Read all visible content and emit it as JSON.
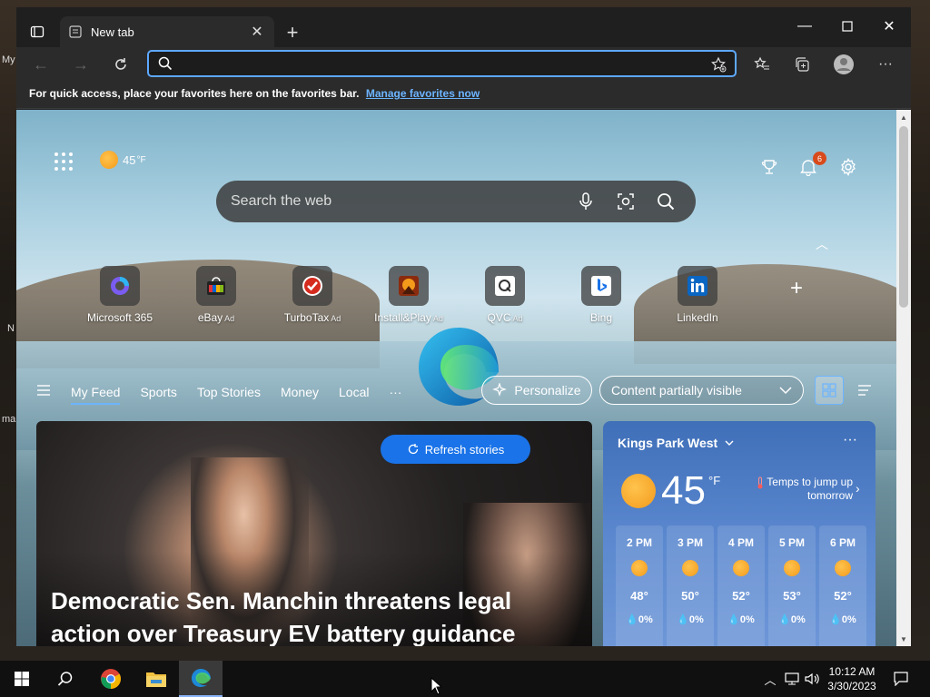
{
  "desktop": {
    "fragments": [
      "My",
      "N",
      "ma"
    ]
  },
  "browser": {
    "tab": {
      "title": "New tab"
    },
    "address_bar": {
      "value": ""
    },
    "favorites_bar": {
      "message": "For quick access, place your favorites here on the favorites bar.",
      "link": "Manage favorites now"
    }
  },
  "newtab": {
    "weather_chip": {
      "temp": "45",
      "unit": "°F"
    },
    "notifications_count": "6",
    "search": {
      "placeholder": "Search the web"
    },
    "quick_links": [
      {
        "label": "Microsoft 365",
        "ad": ""
      },
      {
        "label": "eBay",
        "ad": "Ad"
      },
      {
        "label": "TurboTax",
        "ad": "Ad"
      },
      {
        "label": "Install&Play",
        "ad": "Ad"
      },
      {
        "label": "QVC",
        "ad": "Ad"
      },
      {
        "label": "Bing",
        "ad": ""
      },
      {
        "label": "LinkedIn",
        "ad": ""
      }
    ],
    "feed_nav": {
      "items": [
        "My Feed",
        "Sports",
        "Top Stories",
        "Money",
        "Local"
      ],
      "more": "···",
      "personalize": "Personalize",
      "visibility": "Content partially visible"
    },
    "refresh_label": "Refresh stories",
    "hero": {
      "title": "Democratic Sen. Manchin threatens legal action over Treasury EV battery guidance"
    },
    "weather_card": {
      "location": "Kings Park West",
      "temp": "45",
      "unit": "°F",
      "alert": "Temps to jump up tomorrow",
      "hourly": [
        {
          "time": "2 PM",
          "temp": "48°",
          "precip": "0%"
        },
        {
          "time": "3 PM",
          "temp": "50°",
          "precip": "0%"
        },
        {
          "time": "4 PM",
          "temp": "52°",
          "precip": "0%"
        },
        {
          "time": "5 PM",
          "temp": "53°",
          "precip": "0%"
        },
        {
          "time": "6 PM",
          "temp": "52°",
          "precip": "0%"
        }
      ]
    }
  },
  "taskbar": {
    "clock": {
      "time": "10:12 AM",
      "date": "3/30/2023"
    }
  },
  "colors": {
    "accent": "#1a73e8",
    "address_focus": "#5ea8ff",
    "notification_badge": "#d84a1b",
    "weather_card": "#3f6fb8"
  }
}
